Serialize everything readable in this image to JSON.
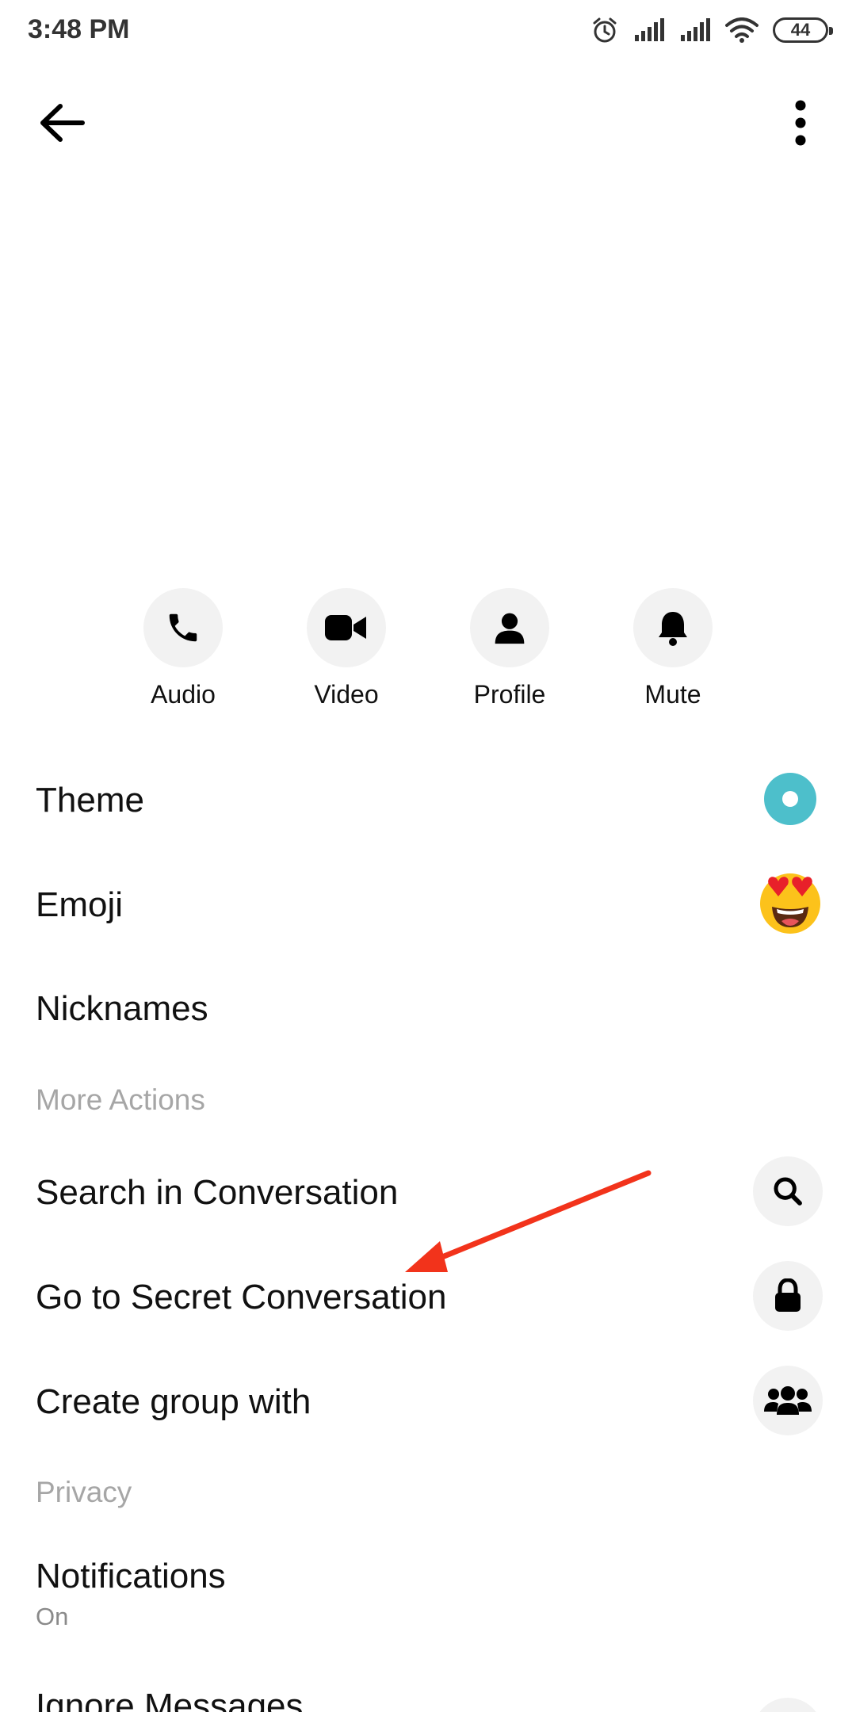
{
  "status_bar": {
    "time": "3:48 PM",
    "battery": "44"
  },
  "quick_actions": [
    {
      "label": "Audio",
      "icon": "phone-icon"
    },
    {
      "label": "Video",
      "icon": "video-camera-icon"
    },
    {
      "label": "Profile",
      "icon": "person-icon"
    },
    {
      "label": "Mute",
      "icon": "bell-icon"
    }
  ],
  "settings": {
    "theme": {
      "label": "Theme",
      "color": "#4dbfcb"
    },
    "emoji": {
      "label": "Emoji",
      "icon": "heart-eyes-emoji-icon"
    },
    "nicknames": {
      "label": "Nicknames"
    }
  },
  "more_actions": {
    "title": "More Actions",
    "search": {
      "label": "Search in Conversation",
      "icon": "search-icon"
    },
    "secret": {
      "label": "Go to Secret Conversation",
      "icon": "lock-icon"
    },
    "group": {
      "label": "Create group with",
      "icon": "group-icon"
    }
  },
  "privacy": {
    "title": "Privacy",
    "notifications": {
      "label": "Notifications",
      "value": "On"
    },
    "ignore": {
      "label": "Ignore Messages",
      "icon": "ignore-icon"
    }
  },
  "annotation": {
    "color": "#f2331b",
    "icon": "red-arrow-annotation"
  }
}
